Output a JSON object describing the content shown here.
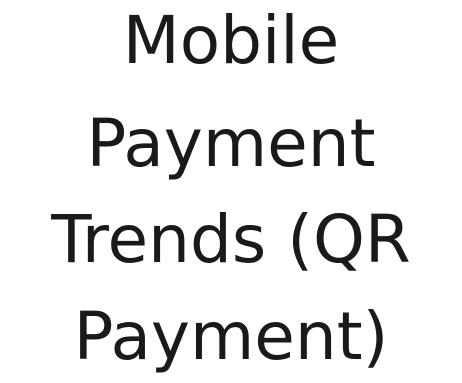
{
  "title": {
    "lines": [
      "Mobile",
      "Payment",
      "Trends (QR",
      "Payment)"
    ]
  },
  "colors": {
    "text": "#1a1a1a",
    "background": "#ffffff"
  }
}
